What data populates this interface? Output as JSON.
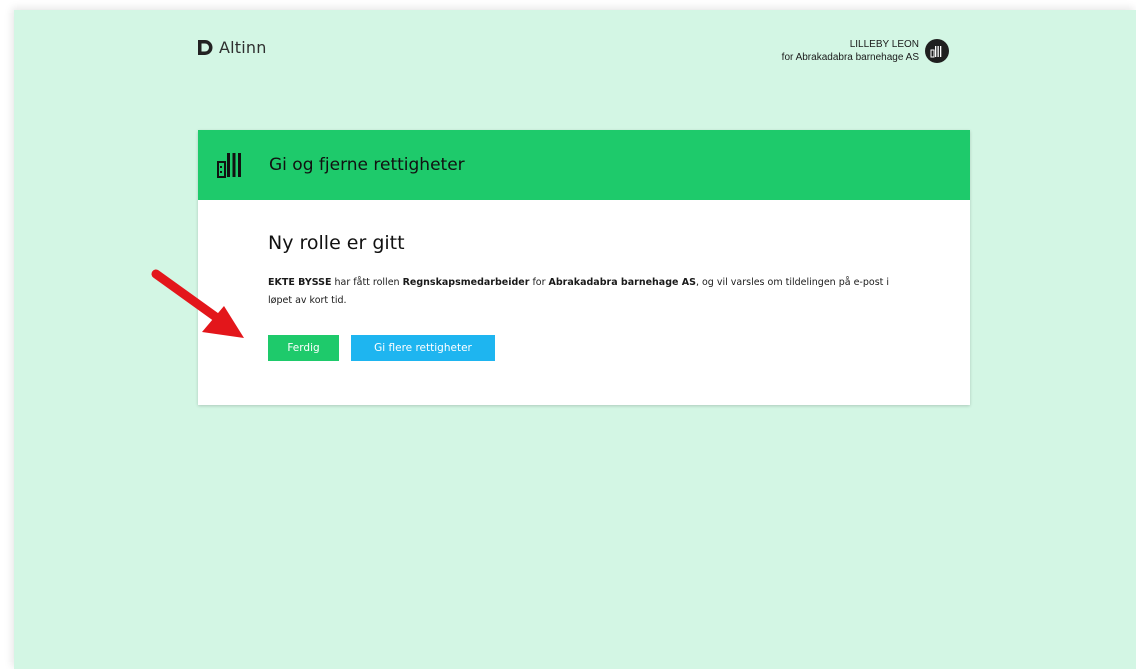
{
  "brand": {
    "name": "Altinn"
  },
  "user": {
    "name": "LILLEBY LEON",
    "org": "for Abrakadabra barnehage AS"
  },
  "card": {
    "title": "Gi og fjerne rettigheter",
    "heading": "Ny rolle er gitt",
    "message": {
      "person": "EKTE BYSSE",
      "text1": " har fått rollen ",
      "role": "Regnskapsmedarbeider",
      "text2": " for ",
      "org": "Abrakadabra barnehage AS",
      "text3": ", og vil varsles om tildelingen på e-post i løpet av kort tid."
    },
    "buttons": {
      "done": "Ferdig",
      "more": "Gi flere rettigheter"
    }
  },
  "colors": {
    "background": "#d3f6e4",
    "accent_green": "#1eca6b",
    "accent_blue": "#1eb5f0",
    "annotation_arrow": "#e3161b"
  }
}
